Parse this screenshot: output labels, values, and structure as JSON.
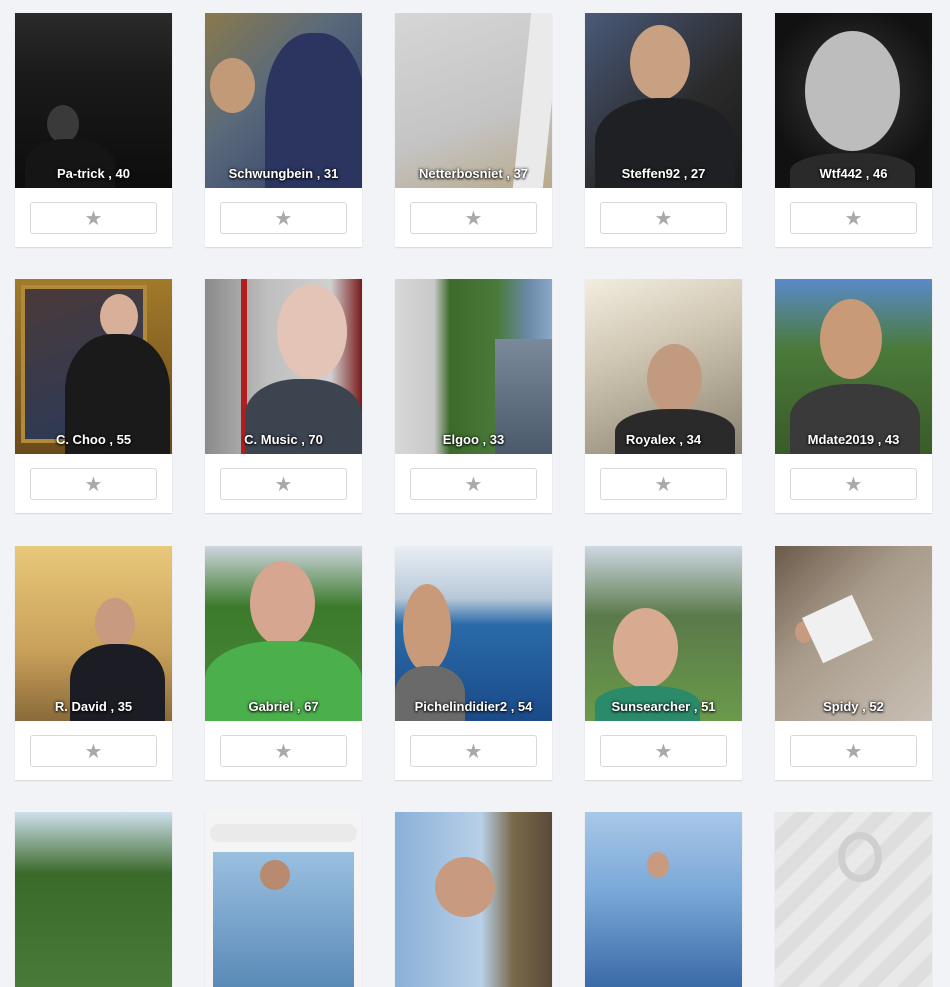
{
  "colors": {
    "page_background": "#f2f3f7",
    "card_background": "#ffffff",
    "star": "#a9a9a9",
    "label_text": "#ffffff"
  },
  "favorite_icon": "star-icon",
  "profiles": [
    {
      "label": "Pa-trick , 40"
    },
    {
      "label": "Schwungbein , 31"
    },
    {
      "label": "Netterbosniet , 37"
    },
    {
      "label": "Steffen92 , 27"
    },
    {
      "label": "Wtf442 , 46"
    },
    {
      "label": "C. Choo , 55"
    },
    {
      "label": "C. Music , 70"
    },
    {
      "label": "Elgoo , 33"
    },
    {
      "label": "Royalex , 34"
    },
    {
      "label": "Mdate2019 , 43"
    },
    {
      "label": "R. David , 35"
    },
    {
      "label": "Gabriel , 67"
    },
    {
      "label": "Pichelindidier2 , 54"
    },
    {
      "label": "Sunsearcher , 51"
    },
    {
      "label": "Spidy , 52"
    },
    {
      "label": ""
    },
    {
      "label": ""
    },
    {
      "label": ""
    },
    {
      "label": ""
    },
    {
      "label": ""
    }
  ]
}
